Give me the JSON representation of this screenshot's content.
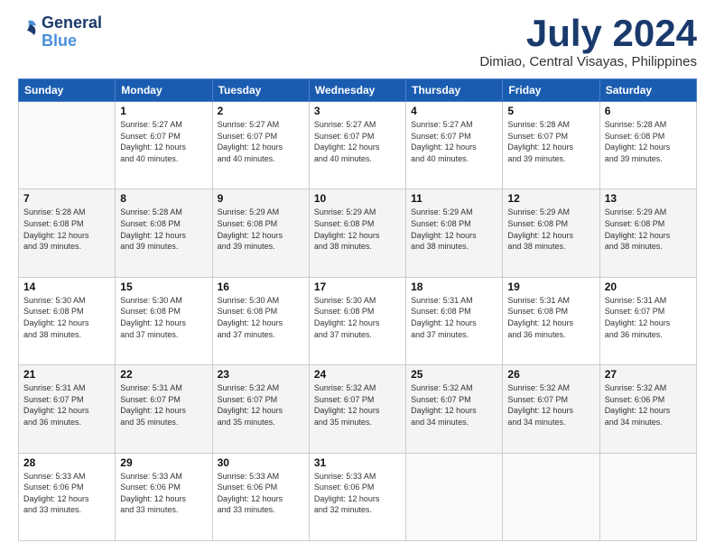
{
  "logo": {
    "line1": "General",
    "line2": "Blue"
  },
  "title": "July 2024",
  "location": "Dimiao, Central Visayas, Philippines",
  "days_header": [
    "Sunday",
    "Monday",
    "Tuesday",
    "Wednesday",
    "Thursday",
    "Friday",
    "Saturday"
  ],
  "weeks": [
    [
      {
        "day": "",
        "info": ""
      },
      {
        "day": "1",
        "info": "Sunrise: 5:27 AM\nSunset: 6:07 PM\nDaylight: 12 hours\nand 40 minutes."
      },
      {
        "day": "2",
        "info": "Sunrise: 5:27 AM\nSunset: 6:07 PM\nDaylight: 12 hours\nand 40 minutes."
      },
      {
        "day": "3",
        "info": "Sunrise: 5:27 AM\nSunset: 6:07 PM\nDaylight: 12 hours\nand 40 minutes."
      },
      {
        "day": "4",
        "info": "Sunrise: 5:27 AM\nSunset: 6:07 PM\nDaylight: 12 hours\nand 40 minutes."
      },
      {
        "day": "5",
        "info": "Sunrise: 5:28 AM\nSunset: 6:07 PM\nDaylight: 12 hours\nand 39 minutes."
      },
      {
        "day": "6",
        "info": "Sunrise: 5:28 AM\nSunset: 6:08 PM\nDaylight: 12 hours\nand 39 minutes."
      }
    ],
    [
      {
        "day": "7",
        "info": "Sunrise: 5:28 AM\nSunset: 6:08 PM\nDaylight: 12 hours\nand 39 minutes."
      },
      {
        "day": "8",
        "info": "Sunrise: 5:28 AM\nSunset: 6:08 PM\nDaylight: 12 hours\nand 39 minutes."
      },
      {
        "day": "9",
        "info": "Sunrise: 5:29 AM\nSunset: 6:08 PM\nDaylight: 12 hours\nand 39 minutes."
      },
      {
        "day": "10",
        "info": "Sunrise: 5:29 AM\nSunset: 6:08 PM\nDaylight: 12 hours\nand 38 minutes."
      },
      {
        "day": "11",
        "info": "Sunrise: 5:29 AM\nSunset: 6:08 PM\nDaylight: 12 hours\nand 38 minutes."
      },
      {
        "day": "12",
        "info": "Sunrise: 5:29 AM\nSunset: 6:08 PM\nDaylight: 12 hours\nand 38 minutes."
      },
      {
        "day": "13",
        "info": "Sunrise: 5:29 AM\nSunset: 6:08 PM\nDaylight: 12 hours\nand 38 minutes."
      }
    ],
    [
      {
        "day": "14",
        "info": "Sunrise: 5:30 AM\nSunset: 6:08 PM\nDaylight: 12 hours\nand 38 minutes."
      },
      {
        "day": "15",
        "info": "Sunrise: 5:30 AM\nSunset: 6:08 PM\nDaylight: 12 hours\nand 37 minutes."
      },
      {
        "day": "16",
        "info": "Sunrise: 5:30 AM\nSunset: 6:08 PM\nDaylight: 12 hours\nand 37 minutes."
      },
      {
        "day": "17",
        "info": "Sunrise: 5:30 AM\nSunset: 6:08 PM\nDaylight: 12 hours\nand 37 minutes."
      },
      {
        "day": "18",
        "info": "Sunrise: 5:31 AM\nSunset: 6:08 PM\nDaylight: 12 hours\nand 37 minutes."
      },
      {
        "day": "19",
        "info": "Sunrise: 5:31 AM\nSunset: 6:08 PM\nDaylight: 12 hours\nand 36 minutes."
      },
      {
        "day": "20",
        "info": "Sunrise: 5:31 AM\nSunset: 6:07 PM\nDaylight: 12 hours\nand 36 minutes."
      }
    ],
    [
      {
        "day": "21",
        "info": "Sunrise: 5:31 AM\nSunset: 6:07 PM\nDaylight: 12 hours\nand 36 minutes."
      },
      {
        "day": "22",
        "info": "Sunrise: 5:31 AM\nSunset: 6:07 PM\nDaylight: 12 hours\nand 35 minutes."
      },
      {
        "day": "23",
        "info": "Sunrise: 5:32 AM\nSunset: 6:07 PM\nDaylight: 12 hours\nand 35 minutes."
      },
      {
        "day": "24",
        "info": "Sunrise: 5:32 AM\nSunset: 6:07 PM\nDaylight: 12 hours\nand 35 minutes."
      },
      {
        "day": "25",
        "info": "Sunrise: 5:32 AM\nSunset: 6:07 PM\nDaylight: 12 hours\nand 34 minutes."
      },
      {
        "day": "26",
        "info": "Sunrise: 5:32 AM\nSunset: 6:07 PM\nDaylight: 12 hours\nand 34 minutes."
      },
      {
        "day": "27",
        "info": "Sunrise: 5:32 AM\nSunset: 6:06 PM\nDaylight: 12 hours\nand 34 minutes."
      }
    ],
    [
      {
        "day": "28",
        "info": "Sunrise: 5:33 AM\nSunset: 6:06 PM\nDaylight: 12 hours\nand 33 minutes."
      },
      {
        "day": "29",
        "info": "Sunrise: 5:33 AM\nSunset: 6:06 PM\nDaylight: 12 hours\nand 33 minutes."
      },
      {
        "day": "30",
        "info": "Sunrise: 5:33 AM\nSunset: 6:06 PM\nDaylight: 12 hours\nand 33 minutes."
      },
      {
        "day": "31",
        "info": "Sunrise: 5:33 AM\nSunset: 6:06 PM\nDaylight: 12 hours\nand 32 minutes."
      },
      {
        "day": "",
        "info": ""
      },
      {
        "day": "",
        "info": ""
      },
      {
        "day": "",
        "info": ""
      }
    ]
  ]
}
